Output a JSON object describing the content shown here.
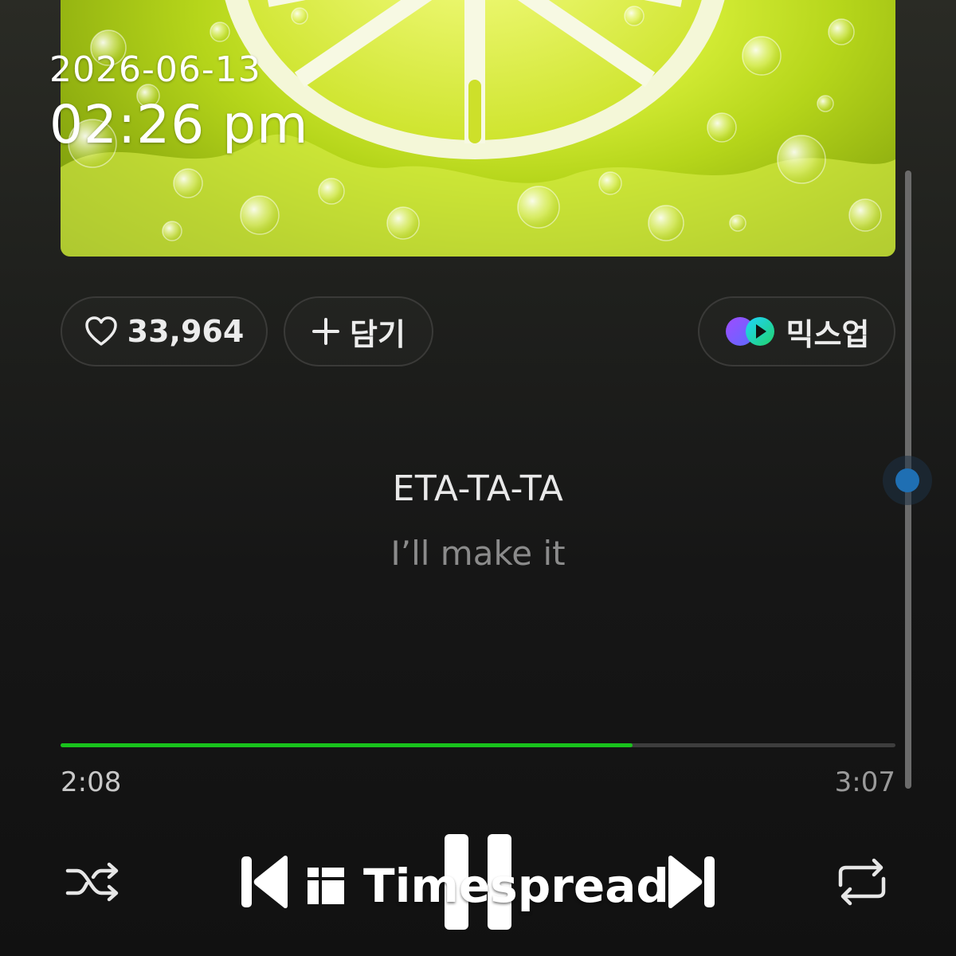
{
  "status_overlay": {
    "date": "2026-06-13",
    "time": "02:26 pm"
  },
  "actions": {
    "like_count": "33,964",
    "add_label": "담기",
    "mixup_label": "믹스업"
  },
  "lyrics": {
    "current_line": "ETA-TA-TA",
    "next_line": "I’ll make it"
  },
  "playback": {
    "elapsed": "2:08",
    "total": "3:07",
    "progress_fraction": 0.685
  },
  "controls": {
    "shuffle_icon": "shuffle-icon",
    "previous_icon": "skip-previous-icon",
    "play_state_icon": "pause-icon",
    "next_icon": "skip-next-icon",
    "repeat_icon": "repeat-icon"
  },
  "watermark": {
    "text": "Timespread"
  },
  "colors": {
    "accent_progress": "#19c21c",
    "scroll_thumb": "#1f6fb3",
    "background": "#161616"
  }
}
